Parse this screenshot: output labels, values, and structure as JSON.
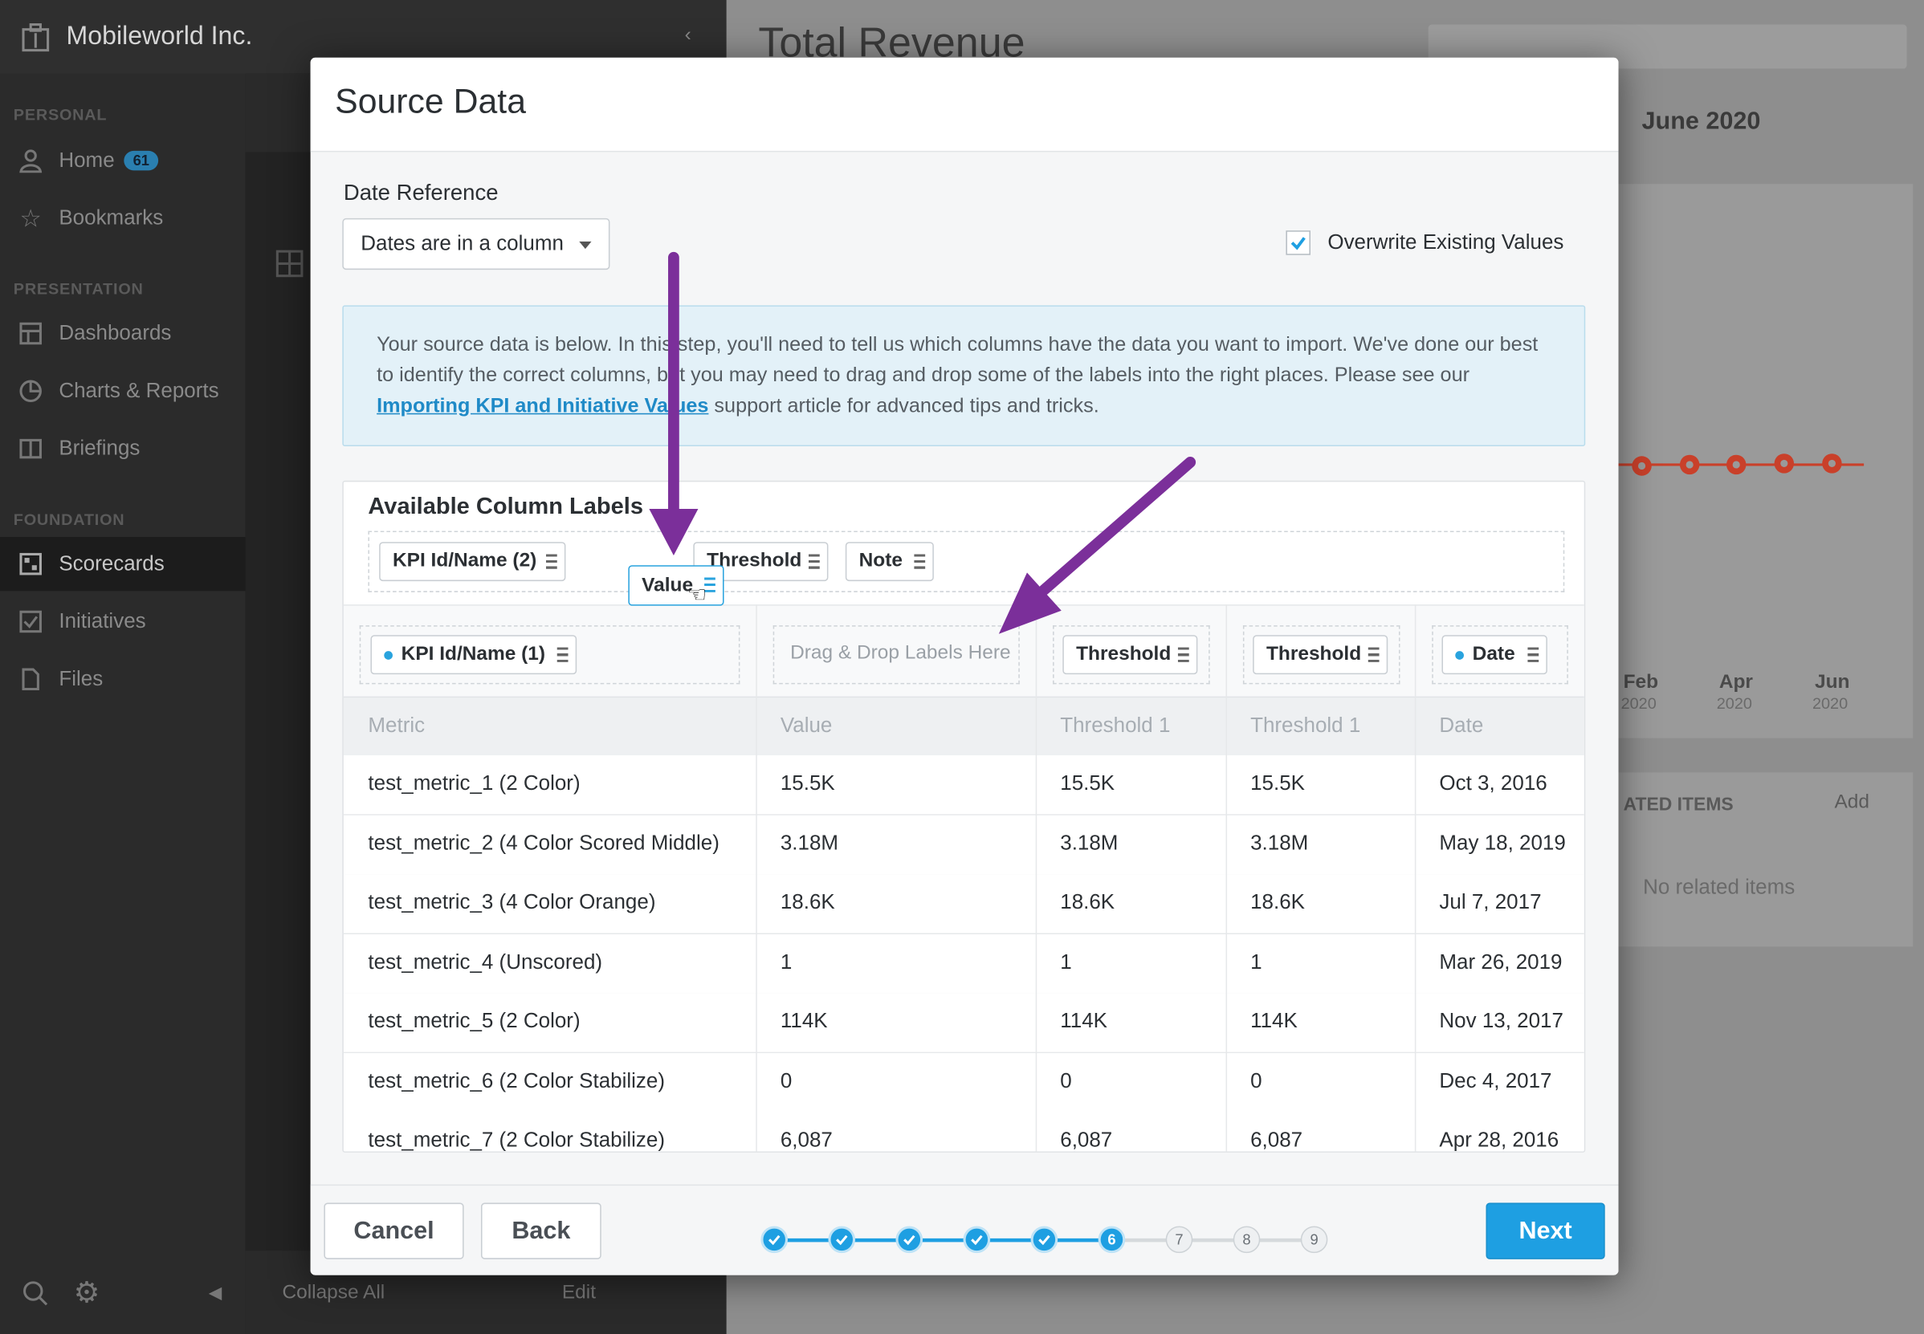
{
  "app": {
    "org_name": "Mobileworld Inc.",
    "page_title": "Total Revenue",
    "period": "June 2020"
  },
  "sidebar": {
    "sections": [
      "PERSONAL",
      "PRESENTATION",
      "FOUNDATION"
    ],
    "items": [
      {
        "label": "Home",
        "badge": "61"
      },
      {
        "label": "Bookmarks"
      },
      {
        "label": "Dashboards"
      },
      {
        "label": "Charts & Reports"
      },
      {
        "label": "Briefings"
      },
      {
        "label": "Scorecards"
      },
      {
        "label": "Initiatives"
      },
      {
        "label": "Files"
      }
    ],
    "collapse_all": "Collapse All",
    "edit": "Edit"
  },
  "background": {
    "axis_months": [
      {
        "m": "Feb",
        "y": "2020"
      },
      {
        "m": "Apr",
        "y": "2020"
      },
      {
        "m": "Jun",
        "y": "2020"
      }
    ],
    "related_items_title": "ATED ITEMS",
    "add_label": "Add",
    "no_related": "No related items"
  },
  "modal": {
    "title": "Source Data",
    "date_reference_label": "Date Reference",
    "date_reference_value": "Dates are in a column",
    "overwrite_label": "Overwrite Existing Values",
    "overwrite_checked": true,
    "info_text_1": "Your source data is below. In this step, you'll need to tell us which columns have the data you want to import. We've done our best to identify the correct columns, but you may need to drag and drop some of the labels into the right places. Please see our ",
    "info_link": "Importing KPI and Initiative Values",
    "info_text_2": " support article for advanced tips and tricks.",
    "available_title": "Available Column Labels",
    "available_labels": [
      "KPI Id/Name (2)",
      "Threshold",
      "Note"
    ],
    "dragging_label": "Value",
    "mapping": [
      "KPI Id/Name (1)",
      "Drag & Drop Labels Here",
      "Threshold",
      "Threshold",
      "Date"
    ],
    "columns": [
      "Metric",
      "Value",
      "Threshold 1",
      "Threshold 1",
      "Date"
    ],
    "rows": [
      [
        "test_metric_1 (2 Color)",
        "15.5K",
        "15.5K",
        "15.5K",
        "Oct 3, 2016"
      ],
      [
        "test_metric_2 (4 Color Scored Middle)",
        "3.18M",
        "3.18M",
        "3.18M",
        "May 18, 2019"
      ],
      [
        "test_metric_3 (4 Color Orange)",
        "18.6K",
        "18.6K",
        "18.6K",
        "Jul 7, 2017"
      ],
      [
        "test_metric_4 (Unscored)",
        "1",
        "1",
        "1",
        "Mar 26, 2019"
      ],
      [
        "test_metric_5 (2 Color)",
        "114K",
        "114K",
        "114K",
        "Nov 13, 2017"
      ],
      [
        "test_metric_6 (2 Color Stabilize)",
        "0",
        "0",
        "0",
        "Dec 4, 2017"
      ],
      [
        "test_metric_7 (2 Color Stabilize)",
        "6,087",
        "6,087",
        "6,087",
        "Apr 28, 2016"
      ]
    ],
    "cancel_label": "Cancel",
    "back_label": "Back",
    "next_label": "Next",
    "steps": [
      "1",
      "2",
      "3",
      "4",
      "5",
      "6",
      "7",
      "8",
      "9"
    ],
    "current_step": 6
  },
  "colors": {
    "accent": "#1e9fe2",
    "annotation_arrow": "#7b2f9a",
    "marker": "#c9402a"
  }
}
